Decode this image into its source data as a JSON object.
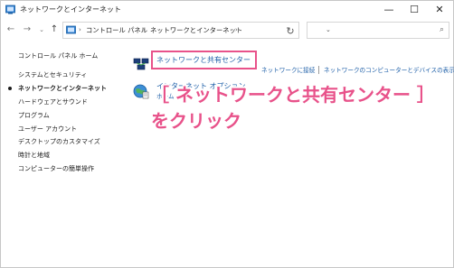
{
  "window": {
    "title": "ネットワークとインターネット",
    "minimize": "—",
    "maximize": "☐",
    "close": "✕",
    "title_icon": "control-panel-icon"
  },
  "nav": {
    "back": "←",
    "forward": "→",
    "recent": "⌄",
    "up": "↑",
    "refresh": "↻",
    "address_separators": [
      "›",
      "›",
      "›"
    ],
    "address_segments": [
      "コントロール パネル",
      "ネットワークとインターネット"
    ],
    "address_dropdown": "⌄",
    "search_placeholder": "",
    "search_icon": "⌕"
  },
  "sidebar": {
    "home": "コントロール パネル ホーム",
    "items": [
      {
        "label": "システムとセキュリティ",
        "active": false
      },
      {
        "label": "ネットワークとインターネット",
        "active": true
      },
      {
        "label": "ハードウェアとサウンド",
        "active": false
      },
      {
        "label": "プログラム",
        "active": false
      },
      {
        "label": "ユーザー アカウント",
        "active": false
      },
      {
        "label": "デスクトップのカスタマイズ",
        "active": false
      },
      {
        "label": "時計と地域",
        "active": false
      },
      {
        "label": "コンピューターの簡単操作",
        "active": false
      }
    ]
  },
  "main": {
    "categories": [
      {
        "title": "ネットワークと共有センター",
        "icon": "network-icon",
        "links": [
          "ネットワークに接続",
          "ネットワークのコンピューターとデバイスの表示"
        ]
      },
      {
        "title": "インターネット オプション",
        "icon": "internet-options-icon",
        "links": [
          "ホーム"
        ]
      }
    ]
  },
  "annotation": {
    "line1": "［ ネットワークと共有センター ］",
    "line2": "をクリック",
    "color": "#e8528a"
  },
  "colors": {
    "link": "#1e5fa8",
    "highlight": "#e8528a"
  }
}
